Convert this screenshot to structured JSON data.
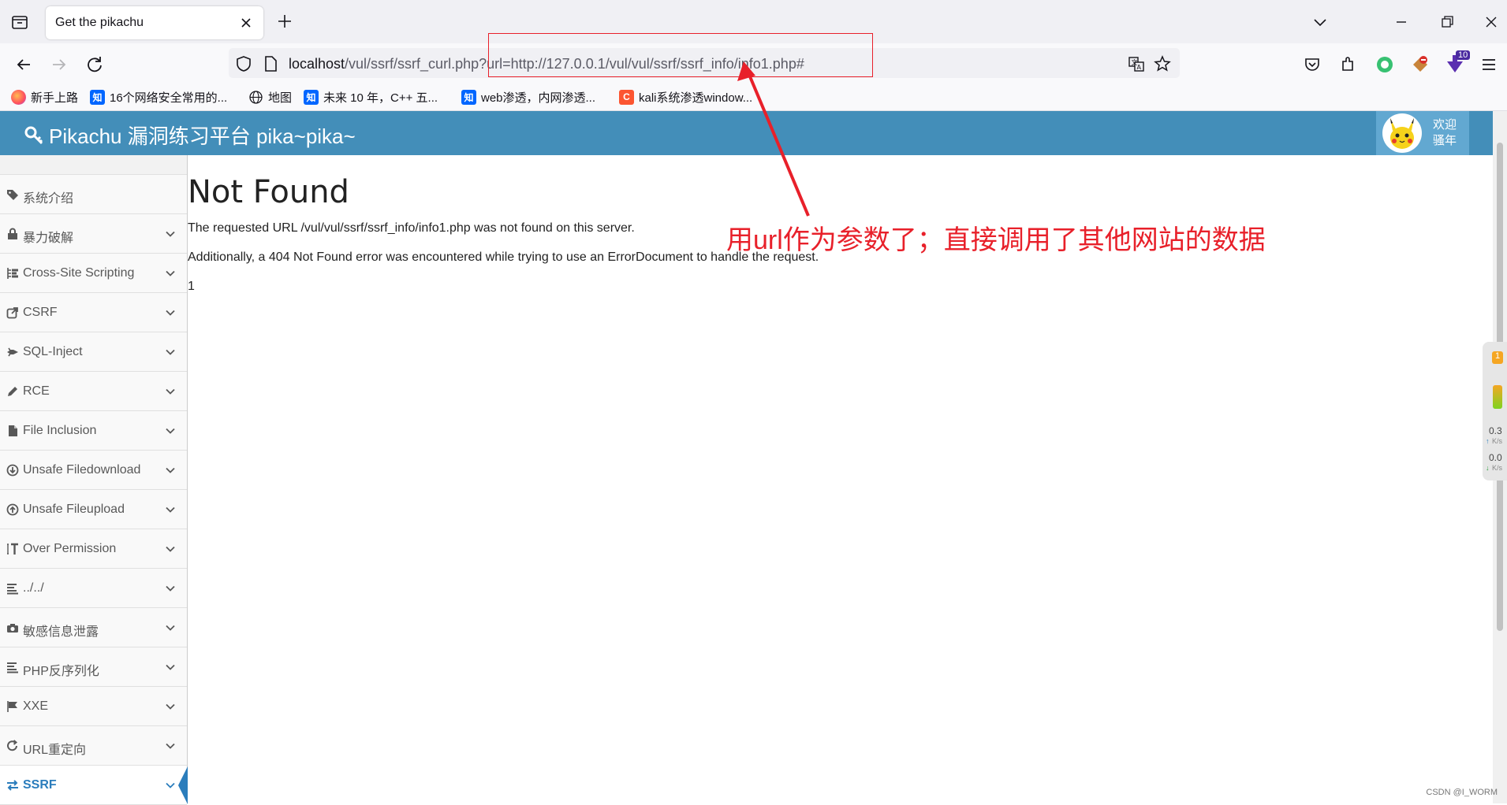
{
  "browser": {
    "tab_title": "Get the pikachu",
    "url_host": "localhost",
    "url_rest": "/vul/ssrf/ssrf_curl.php?url=http://127.0.0.1/vul/vul/ssrf/ssrf_info/info1.php#",
    "bookmarks": [
      {
        "label": "新手上路",
        "icon": "firefox-icon"
      },
      {
        "label": "16个网络安全常用的...",
        "icon": "zhihu-icon"
      },
      {
        "label": "地图",
        "icon": "globe-icon"
      },
      {
        "label": "未来 10 年，C++ 五...",
        "icon": "zhihu-icon"
      },
      {
        "label": "web渗透，内网渗透...",
        "icon": "zhihu-icon"
      },
      {
        "label": "kali系统渗透window...",
        "icon": "csdn-icon"
      }
    ],
    "extension_badge": "10"
  },
  "header": {
    "brand": "Pikachu 漏洞练习平台 pika~pika~",
    "user_line1": "欢迎",
    "user_line2": "骚年"
  },
  "sidebar": {
    "items": [
      {
        "label": "系统介绍",
        "icon": "tags-icon",
        "has_chevron": false
      },
      {
        "label": "暴力破解",
        "icon": "lock-icon",
        "has_chevron": true
      },
      {
        "label": "Cross-Site Scripting",
        "icon": "list-icon",
        "has_chevron": true
      },
      {
        "label": "CSRF",
        "icon": "share-icon",
        "has_chevron": true
      },
      {
        "label": "SQL-Inject",
        "icon": "fighter-jet-icon",
        "has_chevron": true
      },
      {
        "label": "RCE",
        "icon": "pencil-icon",
        "has_chevron": true
      },
      {
        "label": "File Inclusion",
        "icon": "file-icon",
        "has_chevron": true
      },
      {
        "label": "Unsafe Filedownload",
        "icon": "download-icon",
        "has_chevron": true
      },
      {
        "label": "Unsafe Fileupload",
        "icon": "upload-icon",
        "has_chevron": true
      },
      {
        "label": "Over Permission",
        "icon": "text-height-icon",
        "has_chevron": true
      },
      {
        "label": "../../",
        "icon": "align-left-icon",
        "has_chevron": true
      },
      {
        "label": "敏感信息泄露",
        "icon": "camera-icon",
        "has_chevron": true
      },
      {
        "label": "PHP反序列化",
        "icon": "align-left-icon",
        "has_chevron": true
      },
      {
        "label": "XXE",
        "icon": "flag-icon",
        "has_chevron": true
      },
      {
        "label": "URL重定向",
        "icon": "refresh-icon",
        "has_chevron": true
      },
      {
        "label": "SSRF",
        "icon": "exchange-icon",
        "has_chevron": true,
        "active": true
      }
    ]
  },
  "content": {
    "title": "Not Found",
    "p1": "The requested URL /vul/vul/ssrf/ssrf_info/info1.php was not found on this server.",
    "p2": "Additionally, a 404 Not Found error was encountered while trying to use an ErrorDocument to handle the request.",
    "p3": "1"
  },
  "annotation": {
    "text": "用url作为参数了；直接调用了其他网站的数据",
    "color": "#e8202a"
  },
  "widget": {
    "badge": "1",
    "up_value": "0.3",
    "up_unit": "K/s",
    "down_value": "0.0",
    "down_unit": "K/s"
  },
  "watermark": "CSDN @I_WORM"
}
